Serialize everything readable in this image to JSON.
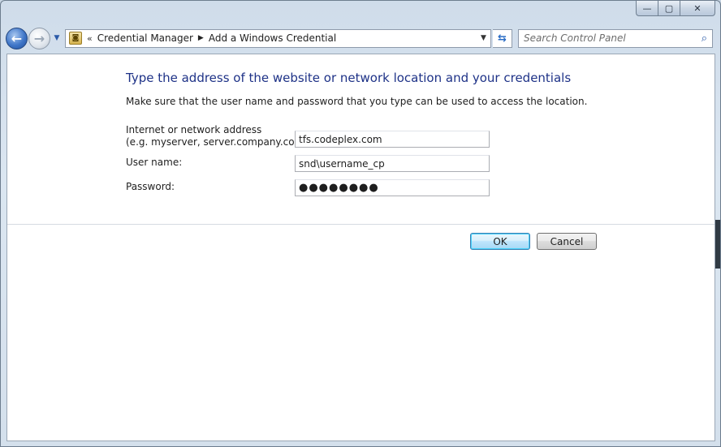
{
  "window": {
    "caption_buttons": {
      "minimize_symbol": "—",
      "maximize_symbol": "▢",
      "close_symbol": "✕"
    }
  },
  "navbar": {
    "back_symbol": "←",
    "forward_symbol": "→",
    "recent_symbol": "▼",
    "address": {
      "overflow_symbol": "«",
      "breadcrumbs": [
        "Credential Manager",
        "Add a Windows Credential"
      ],
      "separator": "▶",
      "dropdown_symbol": "▼"
    },
    "refresh_symbol": "⇆",
    "search": {
      "placeholder": "Search Control Panel",
      "icon": "search-icon"
    }
  },
  "form": {
    "heading": "Type the address of the website or network location and your credentials",
    "subtext": "Make sure that the user name and password that you type can be used to access the location.",
    "fields": [
      {
        "label_line1": "Internet or network address",
        "label_line2": "(e.g. myserver, server.company.com):",
        "value": "tfs.codeplex.com"
      },
      {
        "label_line1": "User name:",
        "value": "snd\\username_cp"
      },
      {
        "label_line1": "Password:",
        "value": "●●●●●●●●"
      }
    ],
    "ok_label": "OK",
    "cancel_label": "Cancel"
  },
  "colors": {
    "heading": "#1e3287",
    "window_frame": "#cfdcea",
    "ok_button_border": "#3c7fb1"
  }
}
